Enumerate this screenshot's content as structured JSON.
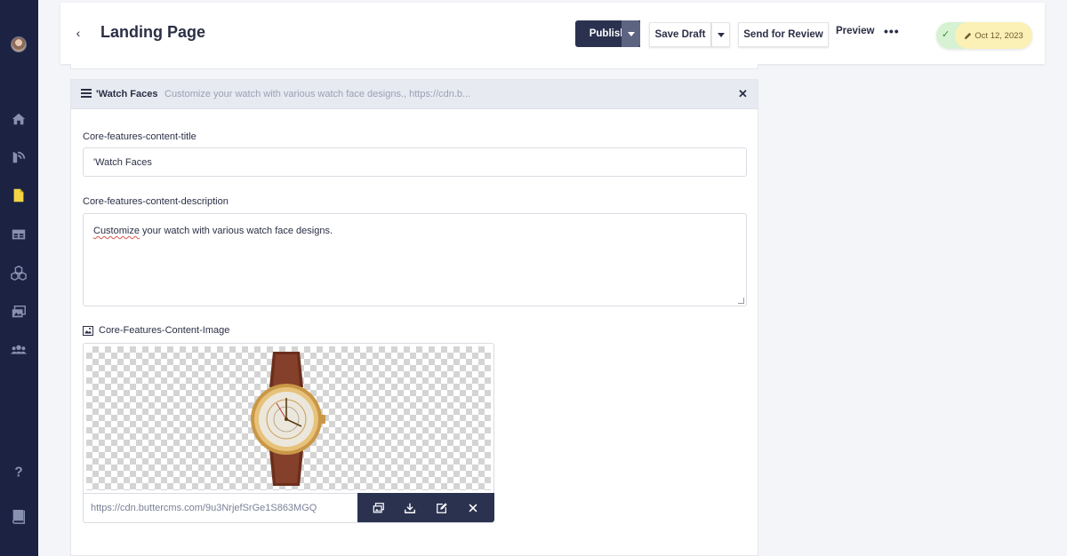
{
  "header": {
    "back_label": "‹",
    "title": "Landing Page",
    "publish_label": "Publish",
    "save_draft_label": "Save Draft",
    "send_review_label": "Send for Review",
    "preview_label": "Preview",
    "more_label": "•••",
    "status_check": "✓",
    "date_label": "Oct 12, 2023"
  },
  "panel": {
    "title": "'Watch Faces",
    "subtitle": "Customize your watch with various watch face designs., https://cdn.b...",
    "close_label": "✕",
    "fields": {
      "title_label": "Core-features-content-title",
      "title_value": "'Watch Faces",
      "description_label": "Core-features-content-description",
      "description_word1": "Customize",
      "description_rest": " your watch with various watch face designs.",
      "image_label": "Core-Features-Content-Image",
      "image_url": "https://cdn.buttercms.com/9u3NrjefSrGe1S863MGQ"
    }
  },
  "colors": {
    "sidebar_bg": "#1b2242",
    "primary_dark": "#2b3250",
    "status_green": "#d6f2d2",
    "date_yellow": "#fbf0b6"
  },
  "sidebar_icons": [
    "avatar",
    "home-icon",
    "blog-icon",
    "pages-icon",
    "collections-icon",
    "components-icon",
    "media-icon",
    "users-icon",
    "help-icon",
    "docs-icon"
  ]
}
